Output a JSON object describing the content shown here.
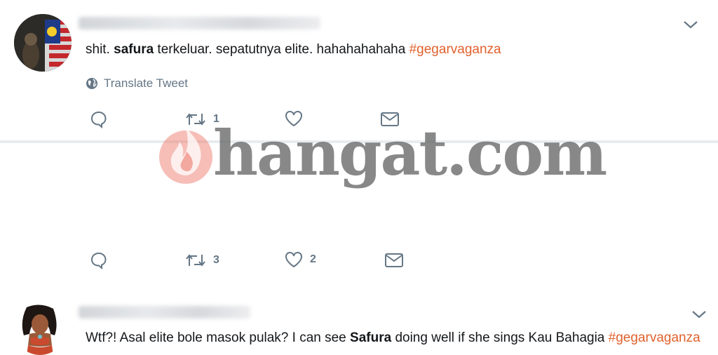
{
  "tweets": [
    {
      "avatar": "avatar-flag",
      "text_parts": [
        "shit. ",
        "safura",
        " terkeluar. sepatutnya elite. hahahahahaha "
      ],
      "hashtag": "#gegarvaganza",
      "translate_label": "Translate Tweet",
      "retweet_count": "1",
      "like_count": ""
    },
    {
      "avatar": "avatar-moana",
      "text_parts": [
        "Wtf?! Asal elite bole masok pulak? I can see ",
        "Safura",
        " doing well if she sings Kau Bahagia "
      ],
      "hashtag": "#gegarvaganza",
      "retweet_count": "3",
      "like_count": "2"
    }
  ],
  "watermark": {
    "text": "hangat.com"
  },
  "colors": {
    "hashtag": "#e0612c",
    "muted": "#657786",
    "divider": "#e9ecef"
  },
  "icons": [
    "reply-icon",
    "retweet-icon",
    "like-icon",
    "dm-icon",
    "globe-icon",
    "chevron-down-icon"
  ]
}
